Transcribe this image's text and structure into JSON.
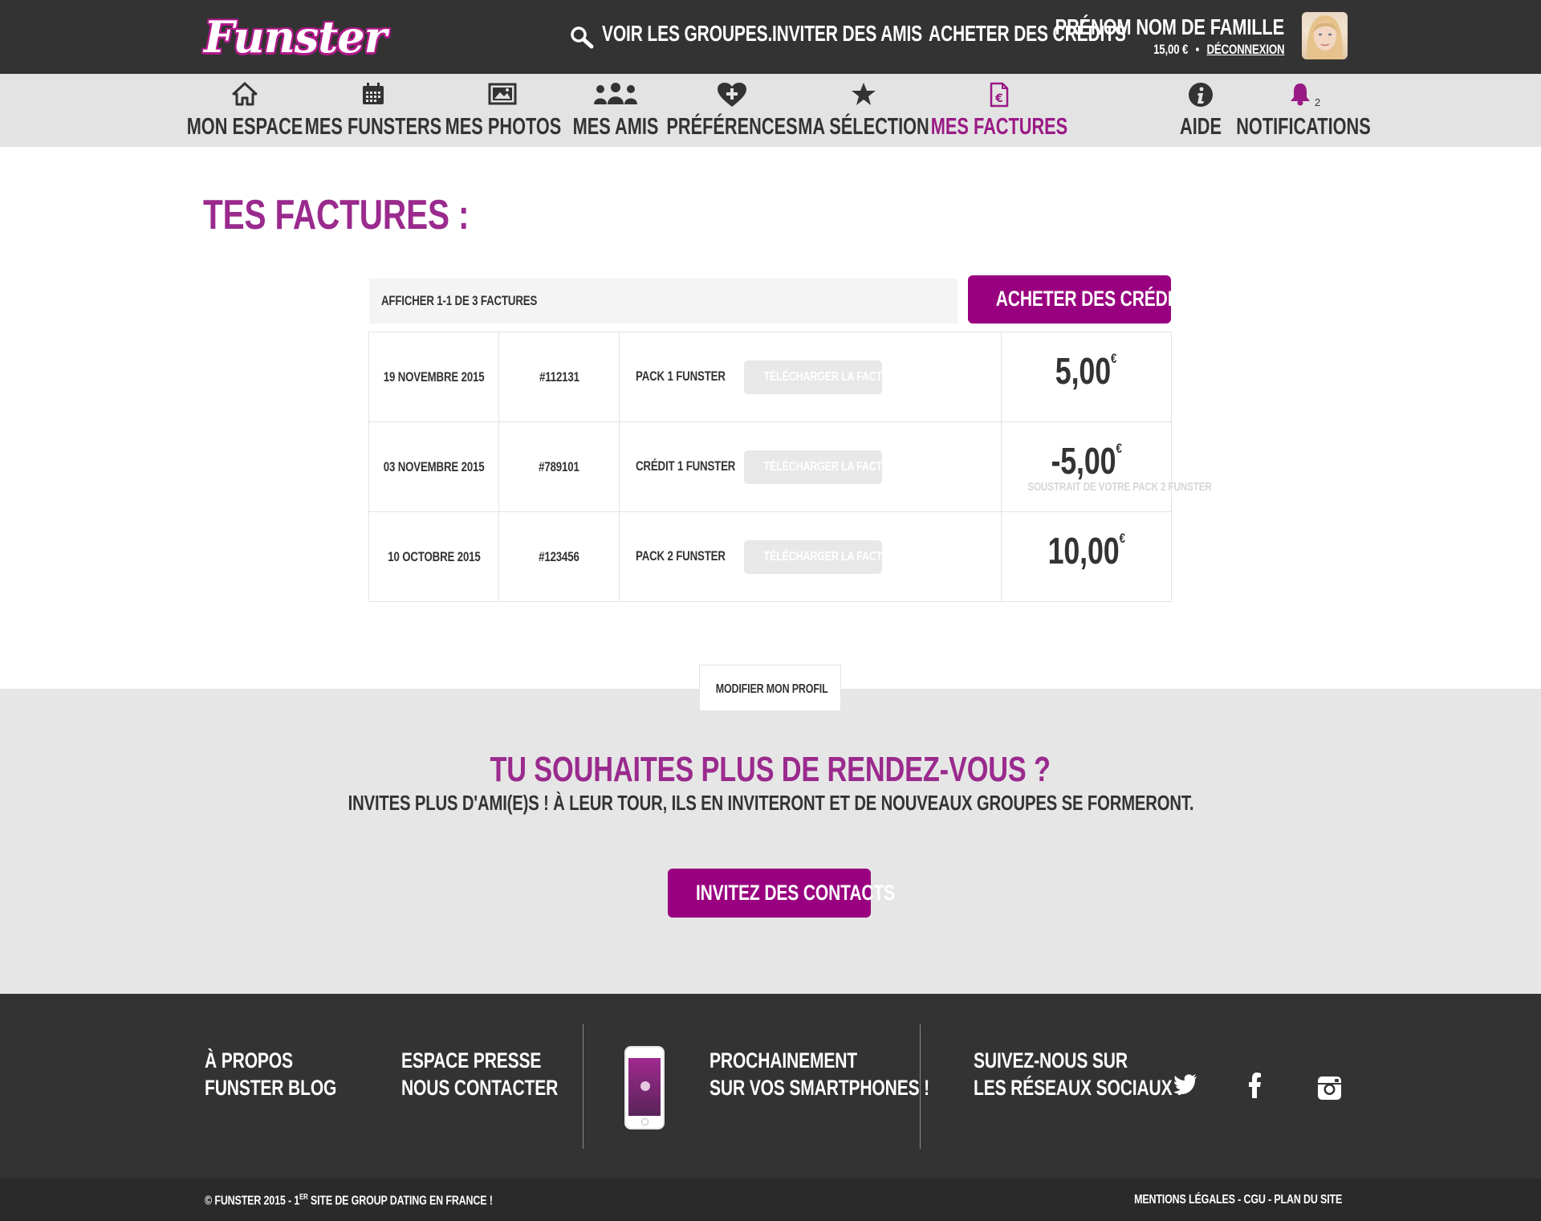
{
  "brand": {
    "logo": "Funster",
    "accent": "#990080"
  },
  "topbar": {
    "search_link": "Voir les groupes...",
    "invite_link": "Inviter des amis",
    "buy_link": "Acheter des crédits",
    "user_name": "Prénom Nom de famille",
    "balance": "15,00 €",
    "separator": "•",
    "logout": "Déconnexion"
  },
  "nav": {
    "items": [
      {
        "label": "Mon espace",
        "icon": "home-icon"
      },
      {
        "label": "Mes funsters",
        "icon": "calendar-icon"
      },
      {
        "label": "Mes photos",
        "icon": "photos-icon"
      },
      {
        "label": "Mes amis",
        "icon": "friends-icon"
      },
      {
        "label": "Préférences",
        "icon": "heart-plus-icon"
      },
      {
        "label": "Ma sélection",
        "icon": "star-icon"
      },
      {
        "label": "Mes factures",
        "icon": "invoice-euro-icon",
        "active": true
      }
    ],
    "help": "Aide",
    "notifications": "Notifications",
    "notification_count": "2"
  },
  "page": {
    "title": "Tes factures :",
    "count_text": "Afficher 1-1 de 3 factures",
    "buy_button": "Acheter des crédits"
  },
  "invoices": [
    {
      "date": "19 novembre 2015",
      "number": "#112131",
      "description": "Pack 1 Funster",
      "download": "Télécharger la facture",
      "amount": "5,00",
      "currency": "€",
      "note": ""
    },
    {
      "date": "03 novembre 2015",
      "number": "#789101",
      "description": "Crédit 1 Funster",
      "download": "Télécharger la facture",
      "amount": "-5,00",
      "currency": "€",
      "note": "Soustrait de votre pack 2 Funster"
    },
    {
      "date": "10 octobre 2015",
      "number": "#123456",
      "description": "Pack 2 Funster",
      "download": "Télécharger la facture",
      "amount": "10,00",
      "currency": "€",
      "note": ""
    }
  ],
  "cta": {
    "edit_profile": "Modifier mon profil",
    "title": "Tu souhaites plus de rendez-vous ?",
    "subtitle": "Invites plus d'ami(e)s ! À leur tour, ils en inviteront et de nouveaux groupes se formeront.",
    "button": "Invitez des contacts"
  },
  "footer": {
    "about": "À propos",
    "blog": "Funster blog",
    "press": "Espace presse",
    "contact": "Nous contacter",
    "mobile_line1": "Prochainement",
    "mobile_line2": "sur vos smartphones !",
    "social_line1": "Suivez-nous sur",
    "social_line2": "les réseaux sociaux :",
    "social_icons": [
      "twitter-icon",
      "facebook-icon",
      "instagram-icon"
    ],
    "copyright_prefix": "© Funster 2015 - 1",
    "copyright_sup": "er",
    "copyright_suffix": " site de group dating en France !",
    "legal": "Mentions légales - CGU - Plan du site"
  }
}
